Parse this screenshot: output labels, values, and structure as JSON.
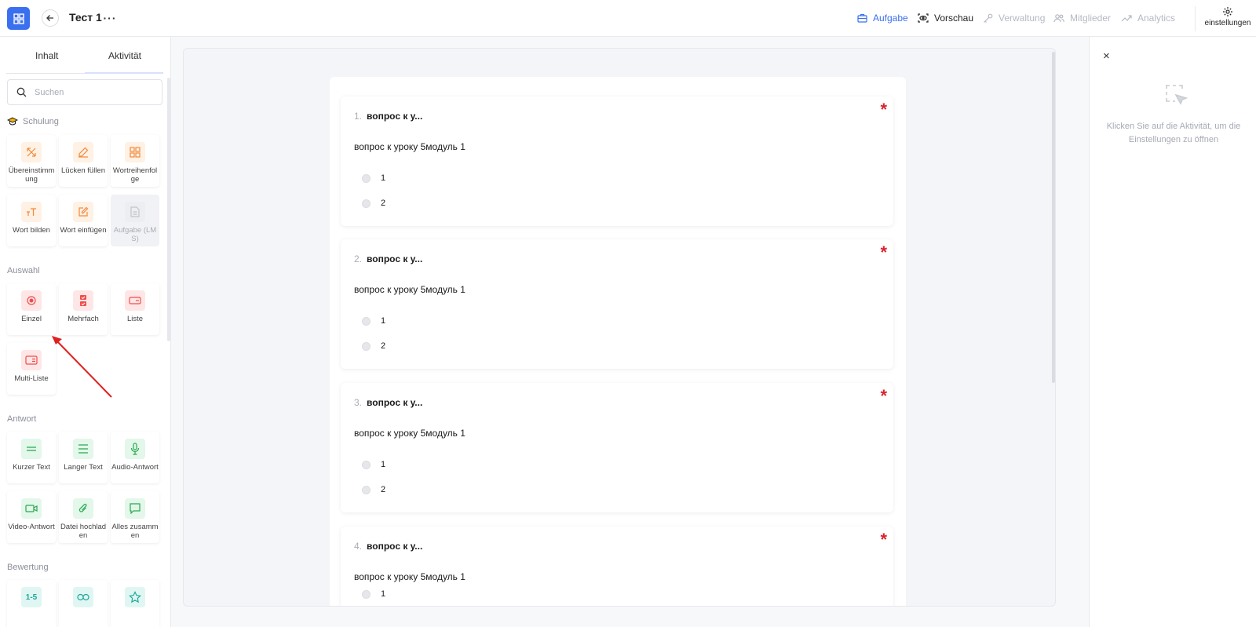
{
  "topbar": {
    "title": "Тест 1",
    "more": "···",
    "nav": {
      "aufgabe": "Aufgabe",
      "vorschau": "Vorschau",
      "verwaltung": "Verwaltung",
      "mitglieder": "Mitglieder",
      "analytics": "Analytics"
    },
    "settings_label": "einstellungen"
  },
  "sidebar": {
    "tabs": {
      "inhalt": "Inhalt",
      "aktivitat": "Aktivität"
    },
    "search_placeholder": "Suchen",
    "sections": {
      "schulung": "Schulung",
      "auswahl": "Auswahl",
      "antwort": "Antwort",
      "bewertung": "Bewertung"
    },
    "schulung_items": [
      "Übereinstimmung",
      "Lücken füllen",
      "Wortreihenfolge",
      "Wort bilden",
      "Wort einfügen",
      "Aufgabe (LMS)"
    ],
    "auswahl_items": [
      "Einzel",
      "Mehrfach",
      "Liste",
      "Multi-Liste"
    ],
    "antwort_items": [
      "Kurzer Text",
      "Langer Text",
      "Audio-Antwort",
      "Video-Antwort",
      "Datei hochladen",
      "Alles zusammen"
    ],
    "bewertung_items": [
      "1-5"
    ]
  },
  "questions": [
    {
      "num": "1.",
      "title": "вопрос к у...",
      "text": "вопрос к уроку 5модуль 1",
      "options": [
        "1",
        "2"
      ]
    },
    {
      "num": "2.",
      "title": "вопрос к у...",
      "text": "вопрос к уроку 5модуль 1",
      "options": [
        "1",
        "2"
      ]
    },
    {
      "num": "3.",
      "title": "вопрос к у...",
      "text": "вопрос к уроку 5модуль 1",
      "options": [
        "1",
        "2"
      ]
    },
    {
      "num": "4.",
      "title": "вопрос к у...",
      "text": "вопрос к уроку 5модуль 1",
      "options": [
        "1"
      ]
    }
  ],
  "required_mark": "*",
  "right_panel": {
    "close": "×",
    "hint": "Klicken Sie auf die Aktivität, um die Einstellungen zu öffnen"
  },
  "colors": {
    "accent": "#3a6ff0",
    "required": "#d9232f",
    "annotation_arrow": "#e02020"
  }
}
